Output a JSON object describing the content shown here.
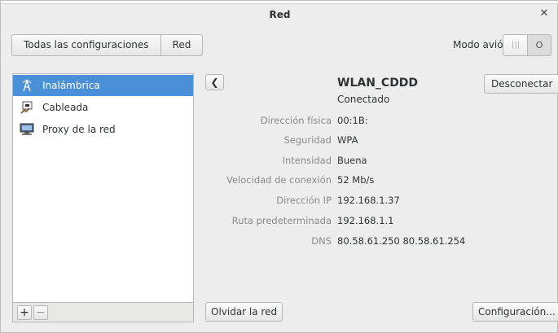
{
  "window": {
    "title": "Red"
  },
  "header": {
    "segments": [
      "Todas las configuraciones",
      "Red"
    ],
    "airplane_label": "Modo avión",
    "airplane_state": "O"
  },
  "sidebar": {
    "items": [
      {
        "label": "Inalámbrica",
        "icon": "wireless-icon",
        "selected": true
      },
      {
        "label": "Cableada",
        "icon": "wired-icon",
        "selected": false
      },
      {
        "label": "Proxy de la red",
        "icon": "proxy-icon",
        "selected": false
      }
    ],
    "add_label": "+",
    "remove_label": "−"
  },
  "network": {
    "name": "WLAN_CDDD",
    "status": "Conectado",
    "disconnect_label": "Desconectar",
    "details": [
      {
        "label": "Dirección física",
        "value": "00:1B:"
      },
      {
        "label": "Seguridad",
        "value": "WPA"
      },
      {
        "label": "Intensidad",
        "value": "Buena"
      },
      {
        "label": "Velocidad de conexión",
        "value": "52 Mb/s"
      },
      {
        "label": "Dirección IP",
        "value": "192.168.1.37"
      },
      {
        "label": "Ruta predeterminada",
        "value": "192.168.1.1"
      },
      {
        "label": "DNS",
        "value": "80.58.61.250 80.58.61.254"
      }
    ],
    "forget_label": "Olvidar la red",
    "settings_label": "Configuración..."
  },
  "colors": {
    "selection": "#4a90d9",
    "label_gray": "#8a8c88"
  }
}
